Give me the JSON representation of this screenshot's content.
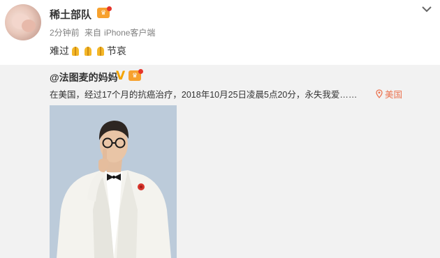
{
  "post": {
    "author": "稀土部队",
    "time": "2分钟前",
    "source_prefix": "来自",
    "source": "iPhone客户端",
    "text_before": "难过",
    "text_after": "节哀",
    "emoji_icon": "pray-icon",
    "emoji_count": 3
  },
  "repost": {
    "author": "@法图麦的妈妈",
    "text": "在美国，经过17个月的抗癌治疗，2018年10月25日凌晨5点20分，永失我爱……",
    "location": "美国"
  },
  "colors": {
    "vip_badge": "#f7a12e",
    "verified": "#f4a300",
    "location": "#eb7350",
    "repost_bg": "#f2f2f2"
  }
}
